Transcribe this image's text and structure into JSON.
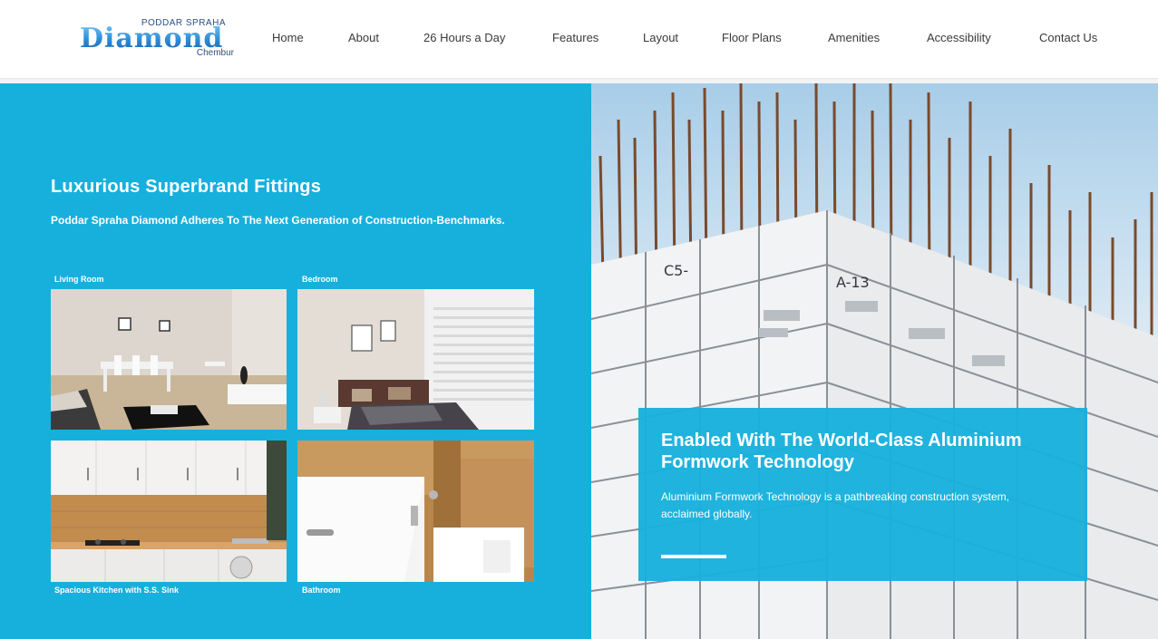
{
  "brand": {
    "top": "PODDAR SPRAHA",
    "main": "Diamond",
    "sub": "Chembur"
  },
  "nav": {
    "items": [
      "Home",
      "About",
      "26 Hours a Day",
      "Features",
      "Layout",
      "Floor Plans",
      "Amenities",
      "Accessibility",
      "Contact Us"
    ]
  },
  "fittings": {
    "title": "Luxurious Superbrand Fittings",
    "description": "Poddar Spraha Diamond Adheres To The Next Generation of Construction-Benchmarks.",
    "photos": [
      {
        "caption": "Living Room"
      },
      {
        "caption": "Bedroom"
      },
      {
        "caption": "Spacious Kitchen with S.S. Sink"
      },
      {
        "caption": "Bathroom"
      }
    ]
  },
  "formwork": {
    "title": "Enabled With The World-Class Aluminium Formwork Technology",
    "description": "Aluminium Formwork Technology is a pathbreaking construction system, acclaimed globally."
  },
  "colors": {
    "accent": "#17b0dc",
    "nav_text": "#3a3a3a",
    "logo_blue": "#2a8ad6"
  }
}
